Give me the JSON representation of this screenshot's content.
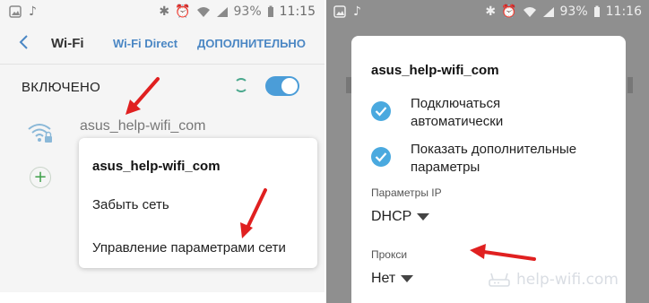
{
  "left_screen": {
    "status_bar": {
      "left_icons": [
        "image-icon",
        "music-note-icon"
      ],
      "right_icons": [
        "bluetooth-icon",
        "alarm-icon",
        "wifi-icon",
        "signal-icon"
      ],
      "battery": "93%",
      "time": "11:15"
    },
    "appbar": {
      "title": "Wi-Fi",
      "tab_direct": "Wi-Fi Direct",
      "tab_advanced": "ДОПОЛНИТЕЛЬНО"
    },
    "wifi_toggle": {
      "label": "ВКЛЮЧЕНО",
      "on": true
    },
    "network": {
      "name": "asus_help-wifi_com"
    },
    "context_menu": {
      "title": "asus_help-wifi_com",
      "items": [
        "Забыть сеть",
        "Управление параметрами сети"
      ]
    }
  },
  "right_screen": {
    "status_bar": {
      "left_icons": [
        "image-icon",
        "music-note-icon"
      ],
      "right_icons": [
        "bluetooth-icon",
        "alarm-icon",
        "wifi-icon",
        "signal-icon"
      ],
      "battery": "93%",
      "time": "11:16"
    },
    "dialog": {
      "title": "asus_help-wifi_com",
      "options": [
        {
          "label": "Подключаться автоматически",
          "checked": true
        },
        {
          "label": "Показать дополнительные параметры",
          "checked": true
        }
      ],
      "ip_settings": {
        "label": "Параметры IP",
        "value": "DHCP"
      },
      "proxy": {
        "label": "Прокси",
        "value": "Нет"
      }
    }
  },
  "watermark": "help-wifi.com",
  "colors": {
    "accent_blue": "#4b87c4",
    "check_blue": "#4aa9df",
    "arrow_red": "#e02020",
    "toggle_blue": "#4b9dd8"
  }
}
